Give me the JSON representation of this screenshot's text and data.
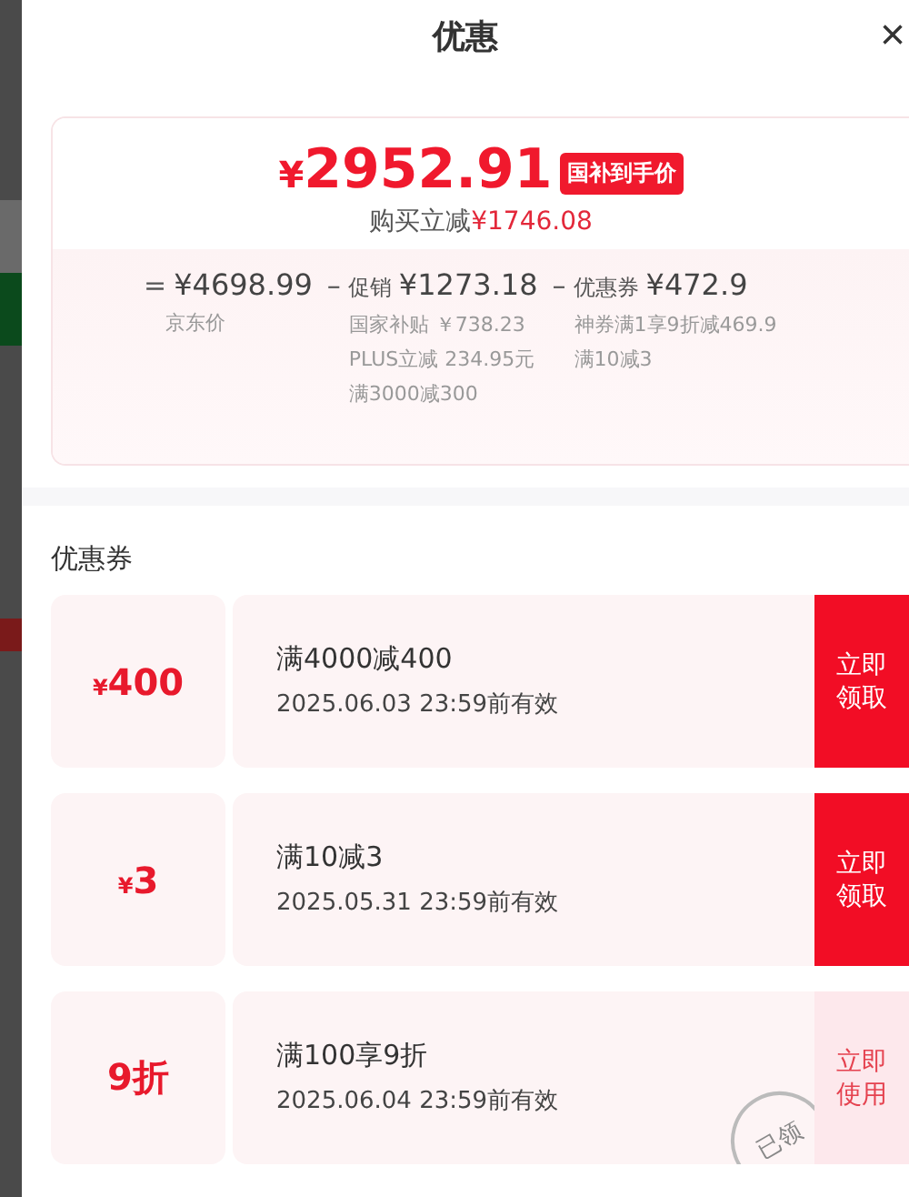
{
  "sheet": {
    "title": "优惠",
    "close": "×"
  },
  "price_card": {
    "currency": "¥",
    "price": "2952.91",
    "badge": "国补到手价",
    "saving_label": "购买立减",
    "saving_amount": "¥1746.08",
    "breakdown": [
      {
        "operator": "=",
        "amount": "¥4698.99",
        "details": [
          "京东价"
        ]
      },
      {
        "operator": "–",
        "name": "促销",
        "amount": "¥1273.18",
        "details": [
          "国家补贴 ￥738.23",
          "PLUS立减 234.95元",
          "满3000减300"
        ]
      },
      {
        "operator": "–",
        "name": "优惠券",
        "amount": "¥472.9",
        "details": [
          "神券满1享9折减469.9",
          "满10减3"
        ]
      }
    ]
  },
  "coupons_title": "优惠券",
  "coupons": [
    {
      "currency": "¥",
      "value": "400",
      "condition": "满4000减400",
      "validity": "2025.06.03 23:59前有效",
      "action": "立即领取",
      "claimed": false
    },
    {
      "currency": "¥",
      "value": "3",
      "condition": "满10减3",
      "validity": "2025.05.31 23:59前有效",
      "action": "立即领取",
      "claimed": false
    },
    {
      "value": "9折",
      "condition": "满100享9折",
      "validity": "2025.06.04 23:59前有效",
      "action": "立即使用",
      "claimed": true,
      "stamp": "已领"
    }
  ]
}
